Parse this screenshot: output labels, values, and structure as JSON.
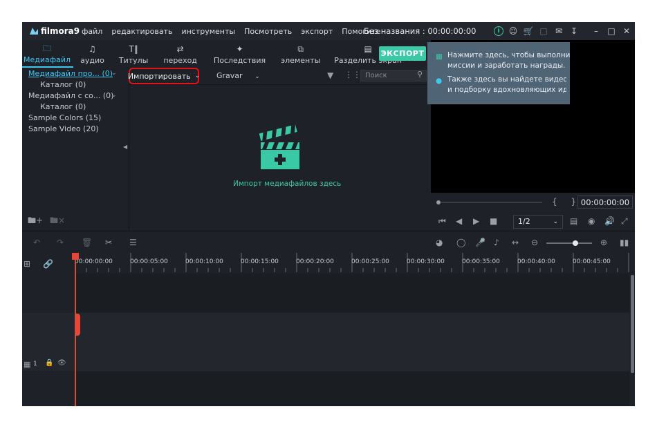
{
  "app": {
    "logo_text": "filmora9",
    "document_title": "Без названия : 00:00:00:00"
  },
  "menu": [
    "файл",
    "редактировать",
    "инструменты",
    "Посмотреть",
    "экспорт",
    "Помогите"
  ],
  "tabs": [
    {
      "label": "Медиафайл",
      "icon": "folder-icon"
    },
    {
      "label": "аудио",
      "icon": "music-note-icon"
    },
    {
      "label": "Титулы",
      "icon": "text-icon"
    },
    {
      "label": "переход",
      "icon": "transition-icon"
    },
    {
      "label": "Последствия",
      "icon": "effects-icon"
    },
    {
      "label": "элементы",
      "icon": "elements-icon"
    },
    {
      "label": "Разделить экран",
      "icon": "split-screen-icon"
    }
  ],
  "export_label": "ЭКСПОРТ",
  "sidebar": {
    "items": [
      "Медиафайл про... (0)",
      "Каталог (0)",
      "Медиафайл с со... (0)",
      "Каталог (0)",
      "Sample Colors (15)",
      "Sample Video (20)"
    ]
  },
  "media": {
    "import_label": "Импортировать",
    "gravar_label": "Gravar",
    "search_placeholder": "Поиск",
    "drop_text": "Импорт медиафайлов здесь"
  },
  "tooltip": {
    "line1a": "Нажмите здесь, чтобы выполни",
    "line1b": "миссии и заработать награды.",
    "line2a": "Также здесь вы найдете видеоу",
    "line2b": "и подборку вдохновляющих ид"
  },
  "preview": {
    "timecode": "00:00:00:00",
    "zoom": "1/2",
    "brackets": "{ }"
  },
  "timeline": {
    "ruler": [
      "00:00:00:00",
      "00:00:05:00",
      "00:00:10:00",
      "00:00:15:00",
      "00:00:20:00",
      "00:00:25:00",
      "00:00:30:00",
      "00:00:35:00",
      "00:00:40:00",
      "00:00:45:00"
    ],
    "video_track_num": "1",
    "audio_track_num": "1"
  },
  "colors": {
    "accent": "#39c9a6",
    "blue": "#3fc8f2",
    "highlight": "#e0131b",
    "playhead": "#e2483a"
  }
}
